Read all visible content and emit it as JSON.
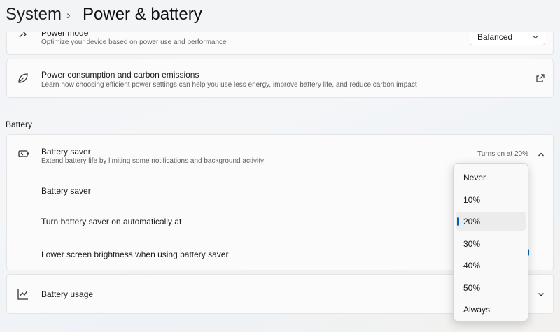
{
  "breadcrumb": {
    "parent": "System",
    "separator": "›",
    "current": "Power & battery"
  },
  "power_mode": {
    "title": "Power mode",
    "subtitle": "Optimize your device based on power use and performance",
    "value": "Balanced"
  },
  "power_consumption": {
    "title": "Power consumption and carbon emissions",
    "subtitle": "Learn how choosing efficient power settings can help you use less energy, improve battery life, and reduce carbon impact"
  },
  "battery_section": {
    "label": "Battery"
  },
  "battery_saver": {
    "title": "Battery saver",
    "subtitle": "Extend battery life by limiting some notifications and background activity",
    "status": "Turns on at 20%",
    "rows": [
      "Battery saver",
      "Turn battery saver on automatically at",
      "Lower screen brightness when using battery saver"
    ]
  },
  "battery_usage": {
    "title": "Battery usage"
  },
  "dropdown": {
    "options": [
      "Never",
      "10%",
      "20%",
      "30%",
      "40%",
      "50%",
      "Always"
    ],
    "selected": "20%"
  },
  "colors": {
    "accent": "#005fb8",
    "card": "#fbfbfb",
    "background": "#f3f4f6"
  }
}
